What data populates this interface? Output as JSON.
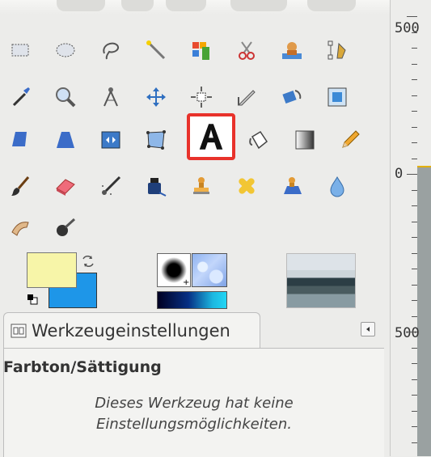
{
  "tools": [
    {
      "name": "rect-select"
    },
    {
      "name": "ellipse-select"
    },
    {
      "name": "free-select"
    },
    {
      "name": "fuzzy-select"
    },
    {
      "name": "select-by-color"
    },
    {
      "name": "scissors-select"
    },
    {
      "name": "foreground-select"
    },
    {
      "name": "paths"
    },
    {
      "name": "color-picker"
    },
    {
      "name": "zoom"
    },
    {
      "name": "measure"
    },
    {
      "name": "move"
    },
    {
      "name": "align"
    },
    {
      "name": "crop"
    },
    {
      "name": "rotate"
    },
    {
      "name": "scale"
    },
    {
      "name": "shear"
    },
    {
      "name": "perspective"
    },
    {
      "name": "flip"
    },
    {
      "name": "cage-transform"
    },
    {
      "name": "text",
      "selected": true
    },
    {
      "name": "bucket-fill"
    },
    {
      "name": "blend"
    },
    {
      "name": "pencil"
    },
    {
      "name": "paintbrush"
    },
    {
      "name": "eraser"
    },
    {
      "name": "airbrush"
    },
    {
      "name": "ink"
    },
    {
      "name": "clone"
    },
    {
      "name": "heal"
    },
    {
      "name": "perspective-clone"
    },
    {
      "name": "blur-sharpen"
    },
    {
      "name": "smudge"
    },
    {
      "name": "dodge-burn"
    }
  ],
  "colors": {
    "foreground": "#f7f5a8",
    "background": "#1e96e8",
    "highlight": "#e8322b"
  },
  "tool_options": {
    "tab_label": "Werkzeugeinstellungen",
    "title": "Farbton/Sättigung",
    "message": "Dieses Werkzeug hat keine Einstellungsmöglichkeiten."
  },
  "ruler": {
    "top_label": "500",
    "middle_label": "0",
    "bottom_label": "500"
  }
}
